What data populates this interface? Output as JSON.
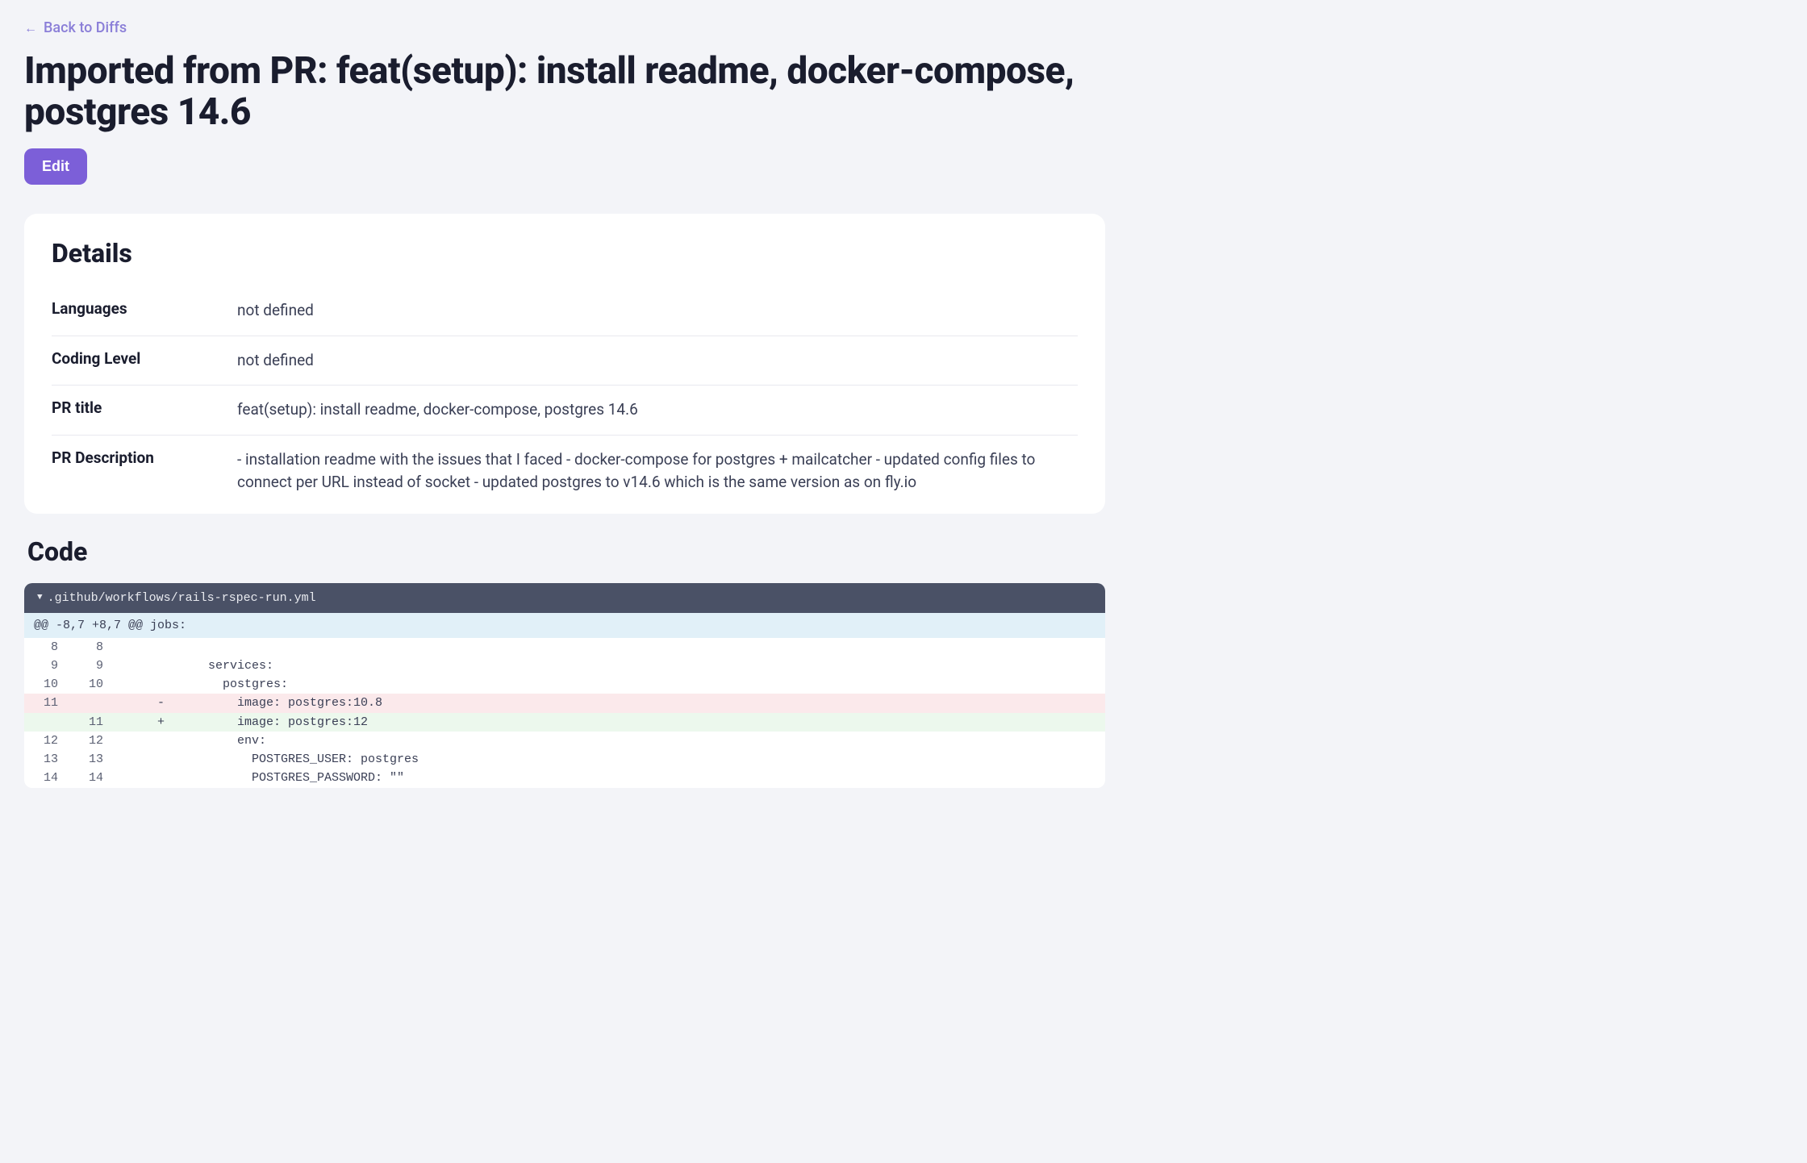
{
  "nav": {
    "back_label": "Back to Diffs"
  },
  "page": {
    "title": "Imported from PR: feat(setup): install readme, docker-compose, postgres 14.6",
    "edit_label": "Edit"
  },
  "details": {
    "heading": "Details",
    "rows": [
      {
        "label": "Languages",
        "value": "not defined"
      },
      {
        "label": "Coding Level",
        "value": "not defined"
      },
      {
        "label": "PR title",
        "value": "feat(setup): install readme, docker-compose, postgres 14.6"
      },
      {
        "label": "PR Description",
        "value": "- installation readme with the issues that I faced - docker-compose for postgres + mailcatcher - updated config files to connect per URL instead of socket - updated postgres to v14.6 which is the same version as on fly.io"
      }
    ]
  },
  "code": {
    "heading": "Code",
    "file": ".github/workflows/rails-rspec-run.yml",
    "hunk_header": "@@ -8,7 +8,7 @@ jobs:",
    "lines": [
      {
        "old": "8",
        "new": "8",
        "sign": "",
        "content": "",
        "type": "ctx"
      },
      {
        "old": "9",
        "new": "9",
        "sign": "",
        "content": "    services:",
        "type": "ctx"
      },
      {
        "old": "10",
        "new": "10",
        "sign": "",
        "content": "      postgres:",
        "type": "ctx"
      },
      {
        "old": "11",
        "new": "",
        "sign": "-",
        "content": "        image: postgres:10.8",
        "type": "removed"
      },
      {
        "old": "",
        "new": "11",
        "sign": "+",
        "content": "        image: postgres:12",
        "type": "added"
      },
      {
        "old": "12",
        "new": "12",
        "sign": "",
        "content": "        env:",
        "type": "ctx"
      },
      {
        "old": "13",
        "new": "13",
        "sign": "",
        "content": "          POSTGRES_USER: postgres",
        "type": "ctx"
      },
      {
        "old": "14",
        "new": "14",
        "sign": "",
        "content": "          POSTGRES_PASSWORD: \"\"",
        "type": "ctx"
      }
    ]
  }
}
